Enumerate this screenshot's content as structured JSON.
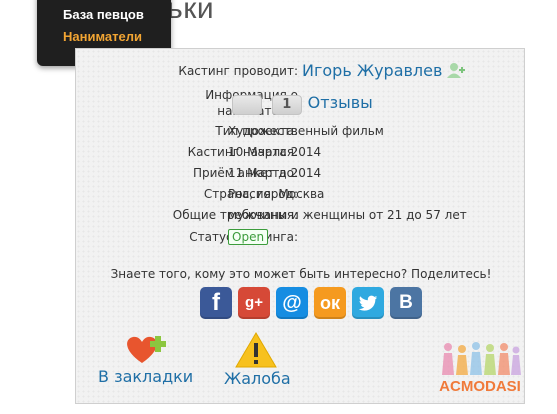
{
  "background": {
    "heading_fragment": "ньки"
  },
  "menu": {
    "items": [
      {
        "label": "База певцов"
      },
      {
        "label": "Наниматели"
      }
    ]
  },
  "casting": {
    "conductor": {
      "label": "Кастинг проводит:",
      "value": "Игорь Журавлев"
    },
    "employer_info": {
      "label": "Информация о нанимателе:",
      "count": "1",
      "reviews": "Отзывы"
    },
    "project_type": {
      "label": "Тип проекта:",
      "value": "Художественный фильм"
    },
    "started": {
      "label": "Кастинг начался:",
      "value": "10 Марта 2014"
    },
    "deadline": {
      "label": "Приём анкет до:",
      "value": "11 Марта 2014"
    },
    "location": {
      "label": "Страна, город:",
      "value": "Россия, Москва"
    },
    "requirements": {
      "label": "Общие требования:",
      "value": "мужчины и женщины от 21 до 57 лет"
    },
    "status": {
      "label": "Статус кастинга:",
      "value": "Open"
    }
  },
  "share": {
    "prompt": "Знаете того, кому это может быть интересно? Поделитесь!",
    "buttons": [
      {
        "name": "facebook",
        "glyph": "f"
      },
      {
        "name": "google-plus",
        "glyph": "g+"
      },
      {
        "name": "mail-ru",
        "glyph": "@"
      },
      {
        "name": "odnoklassniki",
        "glyph": "ок"
      },
      {
        "name": "twitter",
        "glyph": "🐦"
      },
      {
        "name": "vkontakte",
        "glyph": "В"
      }
    ]
  },
  "actions": {
    "bookmark": "В закладки",
    "complaint": "Жалоба"
  },
  "logo": {
    "text": "ACMODASI"
  },
  "colors": {
    "link": "#1f6fa6",
    "menu_active": "#f2a533",
    "status_green": "#3c9c3c"
  }
}
